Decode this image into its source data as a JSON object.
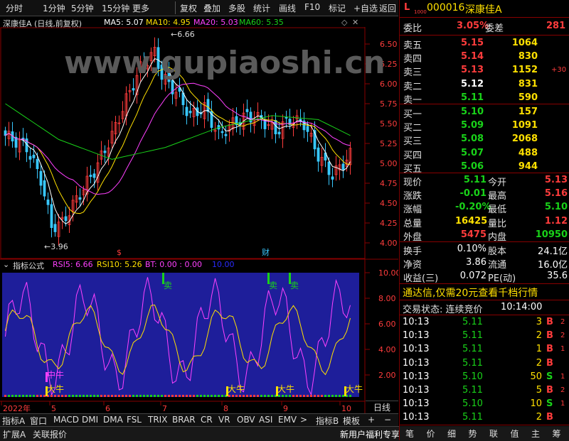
{
  "toolbar": {
    "items": [
      "分时",
      "1分钟",
      "5分钟",
      "15分钟",
      "更多",
      "复权",
      "叠加",
      "多股",
      "统计",
      "画线",
      "F10",
      "标记",
      "+自选",
      "返回"
    ]
  },
  "chart": {
    "stock_title": "深康佳A (日线,前复权)",
    "ma5": "MA5: 5.07",
    "ma10": "MA10: 4.95",
    "ma20": "MA20: 5.03",
    "ma60": "MA60: 5.35",
    "price_labels": [
      "6.50",
      "6.25",
      "6.00",
      "5.75",
      "5.50",
      "5.25",
      "5.00",
      "4.75",
      "4.50",
      "4.25",
      "4.00"
    ],
    "high_mark": "6.66",
    "low_mark": "3.96",
    "event_marks": [
      "$",
      "财"
    ],
    "watermark": "www.gupiaoshi.cn"
  },
  "indicator": {
    "title": "指标公式",
    "rsi5": "RSI5: 6.66",
    "rsi10": "RSI10: 5.26",
    "bt": "BT: 0.00 : 0.00",
    "extra": "10.00",
    "scale": [
      "10.00",
      "8.00",
      "6.00",
      "4.00",
      "2.00"
    ],
    "signals_sell": [
      "卖",
      "卖",
      "卖"
    ],
    "signals_buy": [
      "中牛",
      "大牛",
      "大牛",
      "大牛",
      "大牛"
    ]
  },
  "xaxis": {
    "labels": [
      "2022年",
      "5",
      "6",
      "7",
      "8",
      "9",
      "10"
    ],
    "mode": "日线"
  },
  "tabs": [
    "指标A",
    "窗口",
    "MACD",
    "DMI",
    "DMA",
    "FSL",
    "TRIX",
    "BRAR",
    "CR",
    "VR",
    "OBV",
    "ASI",
    "EMV",
    ">",
    "指标B",
    "模板"
  ],
  "statusbar": {
    "left": [
      "扩展A",
      "关联报价"
    ],
    "promo": "新用户福利专享"
  },
  "quote": {
    "code": "000016",
    "name": "深康佳A",
    "badge": "L",
    "badge_sub": "1000",
    "weibi_label": "委比",
    "weibi": "3.05%",
    "weicha_label": "委差",
    "weicha": "281",
    "asks": [
      {
        "label": "卖五",
        "price": "5.15",
        "vol": "1064",
        "extra": ""
      },
      {
        "label": "卖四",
        "price": "5.14",
        "vol": "830",
        "extra": ""
      },
      {
        "label": "卖三",
        "price": "5.13",
        "vol": "1152",
        "extra": "+30"
      },
      {
        "label": "卖二",
        "price": "5.12",
        "vol": "831",
        "extra": ""
      },
      {
        "label": "卖一",
        "price": "5.11",
        "vol": "590",
        "extra": ""
      }
    ],
    "bids": [
      {
        "label": "买一",
        "price": "5.10",
        "vol": "157"
      },
      {
        "label": "买二",
        "price": "5.09",
        "vol": "1091"
      },
      {
        "label": "买三",
        "price": "5.08",
        "vol": "2068"
      },
      {
        "label": "买四",
        "price": "5.07",
        "vol": "488"
      },
      {
        "label": "买五",
        "price": "5.06",
        "vol": "944"
      }
    ],
    "stats": [
      {
        "l1": "现价",
        "v1": "5.11",
        "l2": "今开",
        "v2": "5.13"
      },
      {
        "l1": "涨跌",
        "v1": "-0.01",
        "l2": "最高",
        "v2": "5.16"
      },
      {
        "l1": "涨幅",
        "v1": "-0.20%",
        "l2": "最低",
        "v2": "5.10"
      },
      {
        "l1": "总量",
        "v1": "16425",
        "l2": "量比",
        "v2": "1.12"
      },
      {
        "l1": "外盘",
        "v1": "5475",
        "l2": "内盘",
        "v2": "10950"
      }
    ],
    "stats2": [
      {
        "l1": "换手",
        "v1": "0.10%",
        "l2": "股本",
        "v2": "24.1亿"
      },
      {
        "l1": "净资",
        "v1": "3.86",
        "l2": "流通",
        "v2": "16.0亿"
      },
      {
        "l1": "收益(三)",
        "v1": "0.072",
        "l2": "PE(动)",
        "v2": "35.6"
      }
    ],
    "banner": "通达信,仅需20元查看千档行情",
    "trade_status_label": "交易状态: 连续竞价",
    "trade_status_time": "10:14:00",
    "ticks": [
      {
        "t": "10:13",
        "p": "5.11",
        "v": "3",
        "d": "B"
      },
      {
        "t": "10:13",
        "p": "5.11",
        "v": "2",
        "d": "B"
      },
      {
        "t": "10:13",
        "p": "5.11",
        "v": "1",
        "d": "B"
      },
      {
        "t": "10:13",
        "p": "5.11",
        "v": "2",
        "d": "B"
      },
      {
        "t": "10:13",
        "p": "5.10",
        "v": "50",
        "d": "S"
      },
      {
        "t": "10:13",
        "p": "5.11",
        "v": "5",
        "d": "B"
      },
      {
        "t": "10:13",
        "p": "5.10",
        "v": "10",
        "d": "S"
      },
      {
        "t": "10:13",
        "p": "5.11",
        "v": "2",
        "d": "B"
      }
    ],
    "tick_extras": [
      "2",
      "2",
      "1",
      "",
      "1",
      "2",
      "1",
      ""
    ],
    "bottom_tabs": [
      "笔",
      "价",
      "细",
      "势",
      "联",
      "值",
      "主",
      "筹"
    ]
  },
  "colors": {
    "up": "#ff3c3c",
    "down": "#19d219",
    "ma5": "#ffffff",
    "ma10": "#ffe000",
    "ma20": "#ff40ff",
    "ma60": "#19d219"
  }
}
